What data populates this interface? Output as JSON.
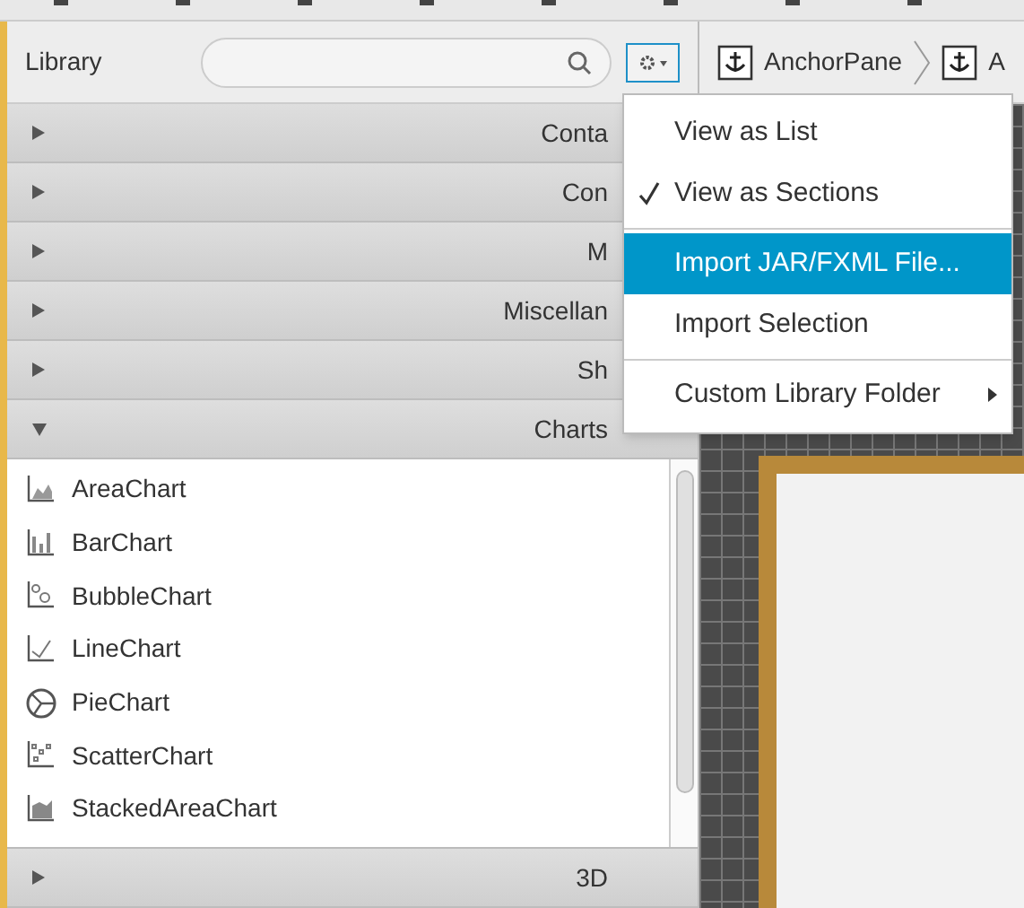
{
  "library": {
    "title": "Library"
  },
  "sections": [
    {
      "label": "Conta",
      "expanded": false
    },
    {
      "label": "Con",
      "expanded": false
    },
    {
      "label": "M",
      "expanded": false
    },
    {
      "label": "Miscellan",
      "expanded": false
    },
    {
      "label": "Sh",
      "expanded": false
    },
    {
      "label": "Charts",
      "expanded": true,
      "items": [
        {
          "label": "AreaChart",
          "kind": "area"
        },
        {
          "label": "BarChart",
          "kind": "bar"
        },
        {
          "label": "BubbleChart",
          "kind": "bubble"
        },
        {
          "label": "LineChart",
          "kind": "line"
        },
        {
          "label": "PieChart",
          "kind": "pie"
        },
        {
          "label": "ScatterChart",
          "kind": "scatter"
        },
        {
          "label": "StackedAreaChart",
          "kind": "stacked"
        }
      ]
    },
    {
      "label": "3D",
      "expanded": false
    }
  ],
  "breadcrumb": [
    {
      "label": "AnchorPane"
    },
    {
      "label": "A"
    }
  ],
  "menu": [
    {
      "kind": "item",
      "label": "View as List",
      "checked": false,
      "selected": false
    },
    {
      "kind": "item",
      "label": "View as Sections",
      "checked": true,
      "selected": false
    },
    {
      "kind": "divider"
    },
    {
      "kind": "item",
      "label": "Import JAR/FXML File...",
      "checked": false,
      "selected": true
    },
    {
      "kind": "item",
      "label": "Import Selection",
      "checked": false,
      "selected": false
    },
    {
      "kind": "divider"
    },
    {
      "kind": "submenu",
      "label": "Custom Library Folder",
      "checked": false,
      "selected": false
    }
  ]
}
